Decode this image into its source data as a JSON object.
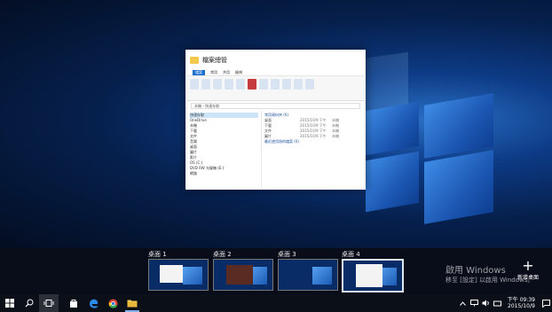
{
  "window_preview": {
    "title": "檔案總管",
    "tabs": [
      "檔案",
      "常用",
      "共用",
      "檢視"
    ],
    "address": "本機 › 快速存取",
    "nav_items": [
      "快速存取",
      "OneDrive",
      "本機",
      "下載",
      "文件",
      "音樂",
      "桌面",
      "圖片",
      "影片",
      "OS (C:)",
      "DVD RW 光碟機 (E:)",
      "網路"
    ],
    "groups": [
      {
        "label": "常用資料夾 (6)",
        "rows": [
          {
            "name": "桌面",
            "date": "2015/10/9 下午",
            "type": "本機"
          },
          {
            "name": "下載",
            "date": "2015/10/9 下午",
            "type": "本機"
          },
          {
            "name": "文件",
            "date": "2015/10/9 下午",
            "type": "本機"
          },
          {
            "name": "圖片",
            "date": "2015/10/9 下午",
            "type": "本機"
          }
        ]
      },
      {
        "label": "最近使用過的檔案 (0)",
        "rows": []
      }
    ]
  },
  "desktops": [
    {
      "label": "桌面 1"
    },
    {
      "label": "桌面 2"
    },
    {
      "label": "桌面 3"
    },
    {
      "label": "桌面 4"
    }
  ],
  "new_desktop": {
    "plus": "+",
    "label": "新增桌面"
  },
  "watermark": {
    "title": "啟用 Windows",
    "subtitle": "移至 [設定] 以啟用 Windows。"
  },
  "taskbar": {
    "time": "下午 09:39",
    "date": "2015/10/9"
  },
  "colors": {
    "accent": "#1a6fd1",
    "wallpaper": "#0d3b86",
    "taskbar": "#0b0f17"
  }
}
